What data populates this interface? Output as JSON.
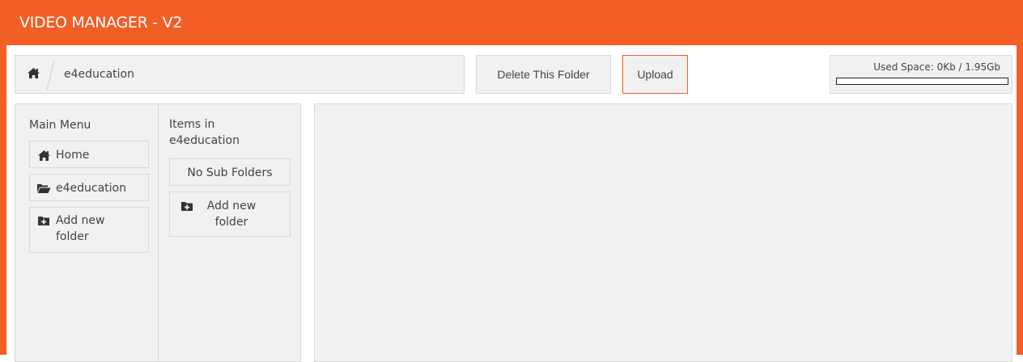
{
  "app": {
    "title": "VIDEO MANAGER - V2"
  },
  "breadcrumb": {
    "home_icon": "home-icon",
    "current": "e4education"
  },
  "toolbar": {
    "delete_label": "Delete This Folder",
    "upload_label": "Upload"
  },
  "usage": {
    "label": "Used Space: 0Kb / 1.95Gb",
    "used_fraction": 0
  },
  "main_menu": {
    "heading": "Main Menu",
    "items": [
      {
        "label": "Home",
        "icon": "home-icon"
      },
      {
        "label": "e4education",
        "icon": "folder-open-icon"
      },
      {
        "label": "Add new folder",
        "icon": "folder-plus-icon"
      }
    ]
  },
  "items_list": {
    "heading": "Items in e4education",
    "empty_text": "No Sub Folders",
    "add_label": "Add new folder",
    "add_icon": "folder-plus-icon"
  },
  "colors": {
    "accent": "#f15e26",
    "panel": "#f1f1f1",
    "border": "#d9d9d9"
  }
}
